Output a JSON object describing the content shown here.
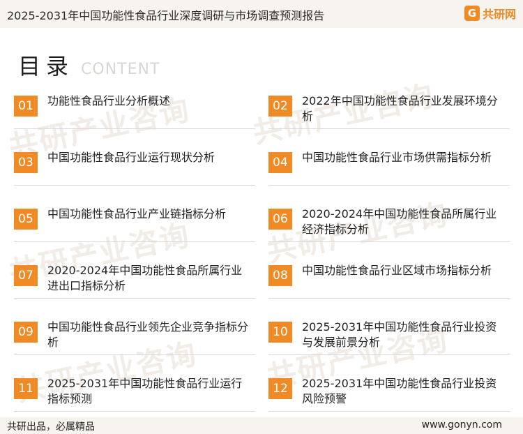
{
  "header": {
    "title": "2025-2031年中国功能性食品行业深度调研与市场调查预测报告",
    "brand_mark": "G",
    "brand_text": "共研网"
  },
  "watermark": {
    "text": "共研产业咨询",
    "url": "www.gonyn.com"
  },
  "toc": {
    "title": "目录",
    "subtitle": "CONTENT",
    "items": [
      {
        "num": "01",
        "label": "功能性食品行业分析概述"
      },
      {
        "num": "02",
        "label": "2022年中国功能性食品行业发展环境分析"
      },
      {
        "num": "03",
        "label": "中国功能性食品行业运行现状分析"
      },
      {
        "num": "04",
        "label": "中国功能性食品行业市场供需指标分析"
      },
      {
        "num": "05",
        "label": "中国功能性食品行业产业链指标分析"
      },
      {
        "num": "06",
        "label": "2020-2024年中国功能性食品所属行业经济指标分析"
      },
      {
        "num": "07",
        "label": "2020-2024年中国功能性食品所属行业进出口指标分析"
      },
      {
        "num": "08",
        "label": "中国功能性食品行业区域市场指标分析"
      },
      {
        "num": "09",
        "label": "中国功能性食品行业领先企业竞争指标分析"
      },
      {
        "num": "10",
        "label": "2025-2031年中国功能性食品行业投资与发展前景分析"
      },
      {
        "num": "11",
        "label": "2025-2031年中国功能性食品行业运行指标预测"
      },
      {
        "num": "12",
        "label": "2025-2031年中国功能性食品行业投资风险预警"
      }
    ]
  },
  "footer": {
    "left": "共研出品，必属精品",
    "right": "www.gonyn.com"
  },
  "colors": {
    "accent": "#f08a24",
    "header_bg": "#f7f3ee"
  }
}
